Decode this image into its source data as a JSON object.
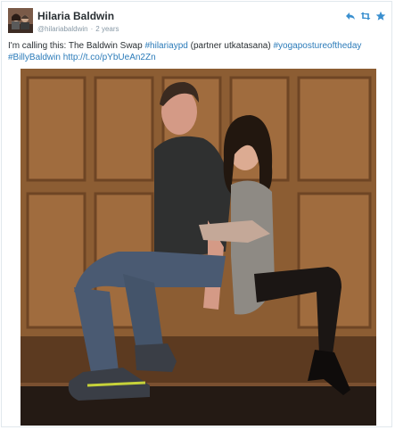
{
  "tweet": {
    "display_name": "Hilaria Baldwin",
    "handle": "@hilariabaldwin",
    "separator": "·",
    "timestamp": "2 years",
    "text_intro": "I'm calling this: The Baldwin Swap ",
    "hashtag_1": "#hilariaypd",
    "text_mid": " (partner utkatasana) ",
    "hashtag_2": "#yogapostureoftheday",
    "hashtag_3": "#BillyBaldwin",
    "link": "http://t.co/pYbUeAn2Zn"
  },
  "actions": [
    {
      "icon": "reply-icon"
    },
    {
      "icon": "retweet-icon"
    },
    {
      "icon": "favorite-icon"
    }
  ],
  "colors": {
    "link": "#2b7bb9",
    "text": "#292f33",
    "meta": "#8899a6",
    "action": "#3a8fcf"
  }
}
